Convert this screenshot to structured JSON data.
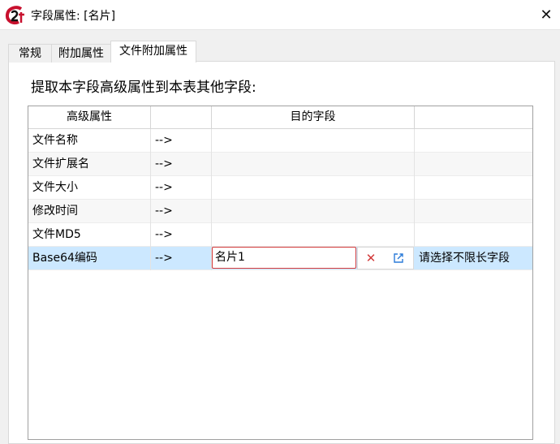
{
  "window": {
    "title": "字段属性:  [名片]",
    "close_glyph": "✕",
    "app_icon": "app-logo-icon"
  },
  "tabs": [
    {
      "label": "常规",
      "active": false
    },
    {
      "label": "附加属性",
      "active": false
    },
    {
      "label": "文件附加属性",
      "active": true
    }
  ],
  "panel": {
    "prompt": "提取本字段高级属性到本表其他字段:"
  },
  "grid": {
    "headers": [
      "高级属性",
      "",
      "目的字段",
      ""
    ],
    "rows": [
      {
        "attr": "文件名称",
        "arrow": "-->",
        "target": "",
        "hint": ""
      },
      {
        "attr": "文件扩展名",
        "arrow": "-->",
        "target": "",
        "hint": ""
      },
      {
        "attr": "文件大小",
        "arrow": "-->",
        "target": "",
        "hint": ""
      },
      {
        "attr": "修改时间",
        "arrow": "-->",
        "target": "",
        "hint": ""
      },
      {
        "attr": "文件MD5",
        "arrow": "-->",
        "target": "",
        "hint": ""
      },
      {
        "attr": "Base64编码",
        "arrow": "-->",
        "target": "名片1",
        "hint": "请选择不限长字段"
      }
    ],
    "editor": {
      "clear_glyph": "✕",
      "clear_icon": "clear-icon",
      "pick_icon": "edit-pick-icon"
    }
  },
  "colors": {
    "selected_row": "#cce8ff",
    "editor_border": "#d43b3b",
    "clear_red": "#d23a3a",
    "pick_blue": "#2b7bd8"
  }
}
